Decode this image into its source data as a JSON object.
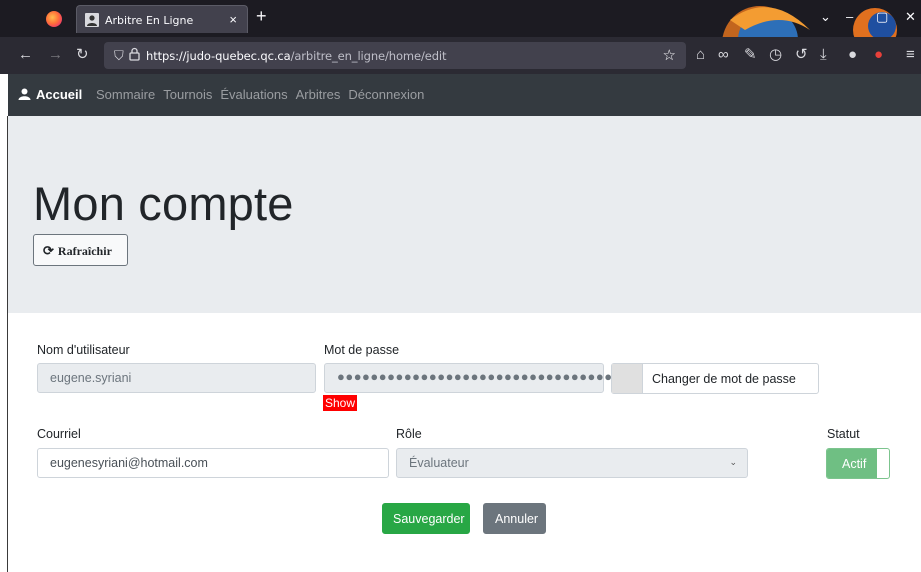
{
  "browser": {
    "tab_title": "Arbitre En Ligne",
    "tab_close": "×",
    "new_tab": "+",
    "url_host": "https://judo-quebec.qc.ca",
    "url_path": "/arbitre_en_ligne/home/edit"
  },
  "nav": {
    "brand": "Accueil",
    "links": [
      "Sommaire",
      "Tournois",
      "Évaluations",
      "Arbitres",
      "Déconnexion"
    ]
  },
  "page": {
    "title": "Mon compte",
    "refresh_label": "Rafraîchir"
  },
  "form": {
    "username_label": "Nom d'utilisateur",
    "username_value": "eugene.syriani",
    "password_label": "Mot de passe",
    "password_mask": "●●●●●●●●●●●●●●●●●●●●●●●●●●●●●●●●●●●",
    "show_label": "Show",
    "change_password_label": "Changer de mot de passe",
    "email_label": "Courriel",
    "email_value": "eugenesyriani@hotmail.com",
    "role_label": "Rôle",
    "role_value": "Évaluateur",
    "status_label": "Statut",
    "status_value": "Actif",
    "save_label": "Sauvegarder",
    "cancel_label": "Annuler"
  },
  "colors": {
    "navbar": "#343a40",
    "jumbotron": "#e9ecef",
    "save": "#28a745",
    "cancel": "#6c757d",
    "toggle_on": "#6fbf83",
    "show_tag": "#ff0000"
  }
}
